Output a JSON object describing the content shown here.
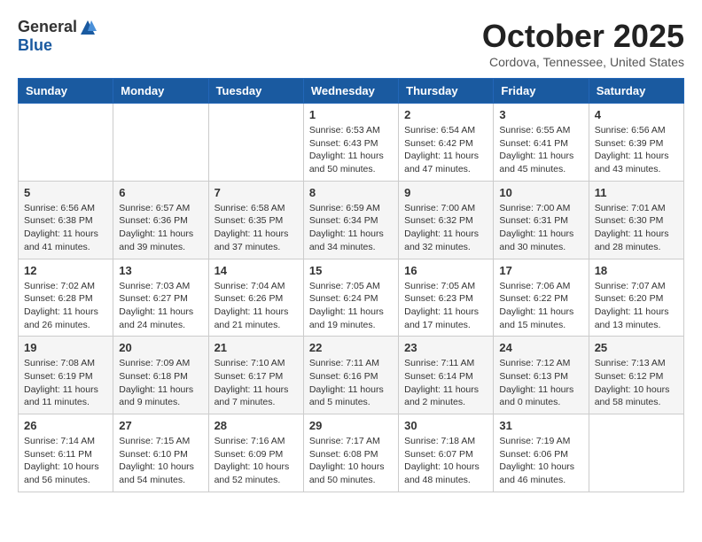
{
  "header": {
    "logo_general": "General",
    "logo_blue": "Blue",
    "month_title": "October 2025",
    "location": "Cordova, Tennessee, United States"
  },
  "weekdays": [
    "Sunday",
    "Monday",
    "Tuesday",
    "Wednesday",
    "Thursday",
    "Friday",
    "Saturday"
  ],
  "weeks": [
    [
      {
        "day": "",
        "info": ""
      },
      {
        "day": "",
        "info": ""
      },
      {
        "day": "",
        "info": ""
      },
      {
        "day": "1",
        "info": "Sunrise: 6:53 AM\nSunset: 6:43 PM\nDaylight: 11 hours\nand 50 minutes."
      },
      {
        "day": "2",
        "info": "Sunrise: 6:54 AM\nSunset: 6:42 PM\nDaylight: 11 hours\nand 47 minutes."
      },
      {
        "day": "3",
        "info": "Sunrise: 6:55 AM\nSunset: 6:41 PM\nDaylight: 11 hours\nand 45 minutes."
      },
      {
        "day": "4",
        "info": "Sunrise: 6:56 AM\nSunset: 6:39 PM\nDaylight: 11 hours\nand 43 minutes."
      }
    ],
    [
      {
        "day": "5",
        "info": "Sunrise: 6:56 AM\nSunset: 6:38 PM\nDaylight: 11 hours\nand 41 minutes."
      },
      {
        "day": "6",
        "info": "Sunrise: 6:57 AM\nSunset: 6:36 PM\nDaylight: 11 hours\nand 39 minutes."
      },
      {
        "day": "7",
        "info": "Sunrise: 6:58 AM\nSunset: 6:35 PM\nDaylight: 11 hours\nand 37 minutes."
      },
      {
        "day": "8",
        "info": "Sunrise: 6:59 AM\nSunset: 6:34 PM\nDaylight: 11 hours\nand 34 minutes."
      },
      {
        "day": "9",
        "info": "Sunrise: 7:00 AM\nSunset: 6:32 PM\nDaylight: 11 hours\nand 32 minutes."
      },
      {
        "day": "10",
        "info": "Sunrise: 7:00 AM\nSunset: 6:31 PM\nDaylight: 11 hours\nand 30 minutes."
      },
      {
        "day": "11",
        "info": "Sunrise: 7:01 AM\nSunset: 6:30 PM\nDaylight: 11 hours\nand 28 minutes."
      }
    ],
    [
      {
        "day": "12",
        "info": "Sunrise: 7:02 AM\nSunset: 6:28 PM\nDaylight: 11 hours\nand 26 minutes."
      },
      {
        "day": "13",
        "info": "Sunrise: 7:03 AM\nSunset: 6:27 PM\nDaylight: 11 hours\nand 24 minutes."
      },
      {
        "day": "14",
        "info": "Sunrise: 7:04 AM\nSunset: 6:26 PM\nDaylight: 11 hours\nand 21 minutes."
      },
      {
        "day": "15",
        "info": "Sunrise: 7:05 AM\nSunset: 6:24 PM\nDaylight: 11 hours\nand 19 minutes."
      },
      {
        "day": "16",
        "info": "Sunrise: 7:05 AM\nSunset: 6:23 PM\nDaylight: 11 hours\nand 17 minutes."
      },
      {
        "day": "17",
        "info": "Sunrise: 7:06 AM\nSunset: 6:22 PM\nDaylight: 11 hours\nand 15 minutes."
      },
      {
        "day": "18",
        "info": "Sunrise: 7:07 AM\nSunset: 6:20 PM\nDaylight: 11 hours\nand 13 minutes."
      }
    ],
    [
      {
        "day": "19",
        "info": "Sunrise: 7:08 AM\nSunset: 6:19 PM\nDaylight: 11 hours\nand 11 minutes."
      },
      {
        "day": "20",
        "info": "Sunrise: 7:09 AM\nSunset: 6:18 PM\nDaylight: 11 hours\nand 9 minutes."
      },
      {
        "day": "21",
        "info": "Sunrise: 7:10 AM\nSunset: 6:17 PM\nDaylight: 11 hours\nand 7 minutes."
      },
      {
        "day": "22",
        "info": "Sunrise: 7:11 AM\nSunset: 6:16 PM\nDaylight: 11 hours\nand 5 minutes."
      },
      {
        "day": "23",
        "info": "Sunrise: 7:11 AM\nSunset: 6:14 PM\nDaylight: 11 hours\nand 2 minutes."
      },
      {
        "day": "24",
        "info": "Sunrise: 7:12 AM\nSunset: 6:13 PM\nDaylight: 11 hours\nand 0 minutes."
      },
      {
        "day": "25",
        "info": "Sunrise: 7:13 AM\nSunset: 6:12 PM\nDaylight: 10 hours\nand 58 minutes."
      }
    ],
    [
      {
        "day": "26",
        "info": "Sunrise: 7:14 AM\nSunset: 6:11 PM\nDaylight: 10 hours\nand 56 minutes."
      },
      {
        "day": "27",
        "info": "Sunrise: 7:15 AM\nSunset: 6:10 PM\nDaylight: 10 hours\nand 54 minutes."
      },
      {
        "day": "28",
        "info": "Sunrise: 7:16 AM\nSunset: 6:09 PM\nDaylight: 10 hours\nand 52 minutes."
      },
      {
        "day": "29",
        "info": "Sunrise: 7:17 AM\nSunset: 6:08 PM\nDaylight: 10 hours\nand 50 minutes."
      },
      {
        "day": "30",
        "info": "Sunrise: 7:18 AM\nSunset: 6:07 PM\nDaylight: 10 hours\nand 48 minutes."
      },
      {
        "day": "31",
        "info": "Sunrise: 7:19 AM\nSunset: 6:06 PM\nDaylight: 10 hours\nand 46 minutes."
      },
      {
        "day": "",
        "info": ""
      }
    ]
  ]
}
